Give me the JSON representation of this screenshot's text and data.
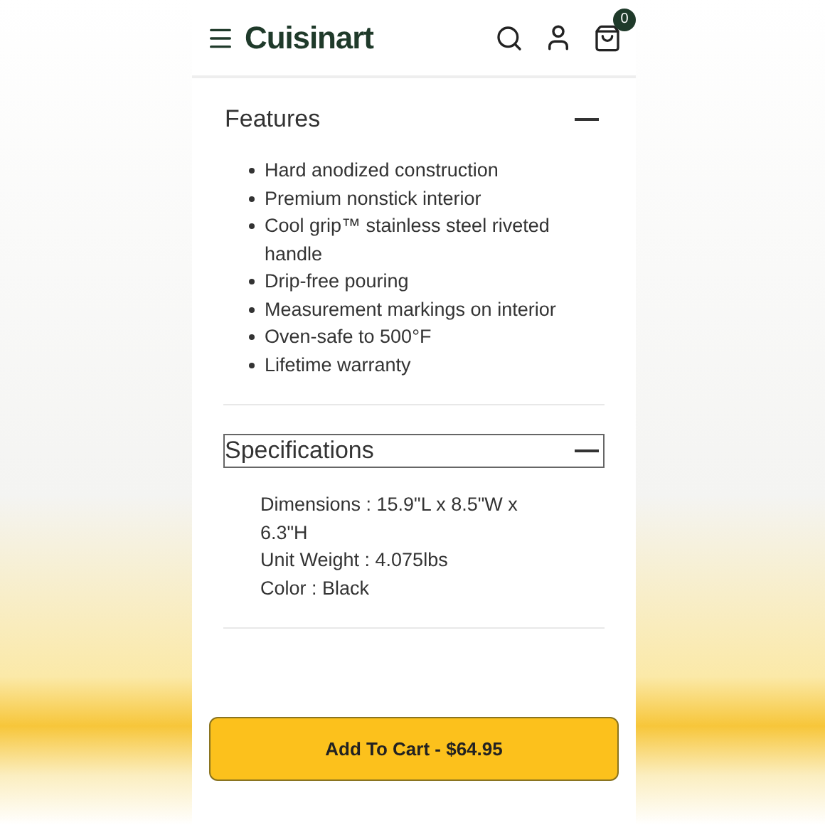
{
  "header": {
    "logo": "Cuisinart",
    "cart_count": "0"
  },
  "sections": [
    {
      "title": "Features",
      "expanded": true,
      "focused": false,
      "kind": "bullets",
      "items": [
        "Hard anodized construction",
        "Premium nonstick interior",
        "Cool grip™ stainless steel riveted handle",
        "Drip-free pouring",
        "Measurement markings on interior",
        "Oven-safe to 500°F",
        "Lifetime warranty"
      ]
    },
    {
      "title": "Specifications",
      "expanded": true,
      "focused": true,
      "kind": "lines",
      "items": [
        "Dimensions : 15.9\"L x 8.5\"W x 6.3\"H",
        "Unit Weight : 4.075lbs",
        "Color : Black"
      ]
    }
  ],
  "add_to_cart": "Add To Cart - $64.95"
}
